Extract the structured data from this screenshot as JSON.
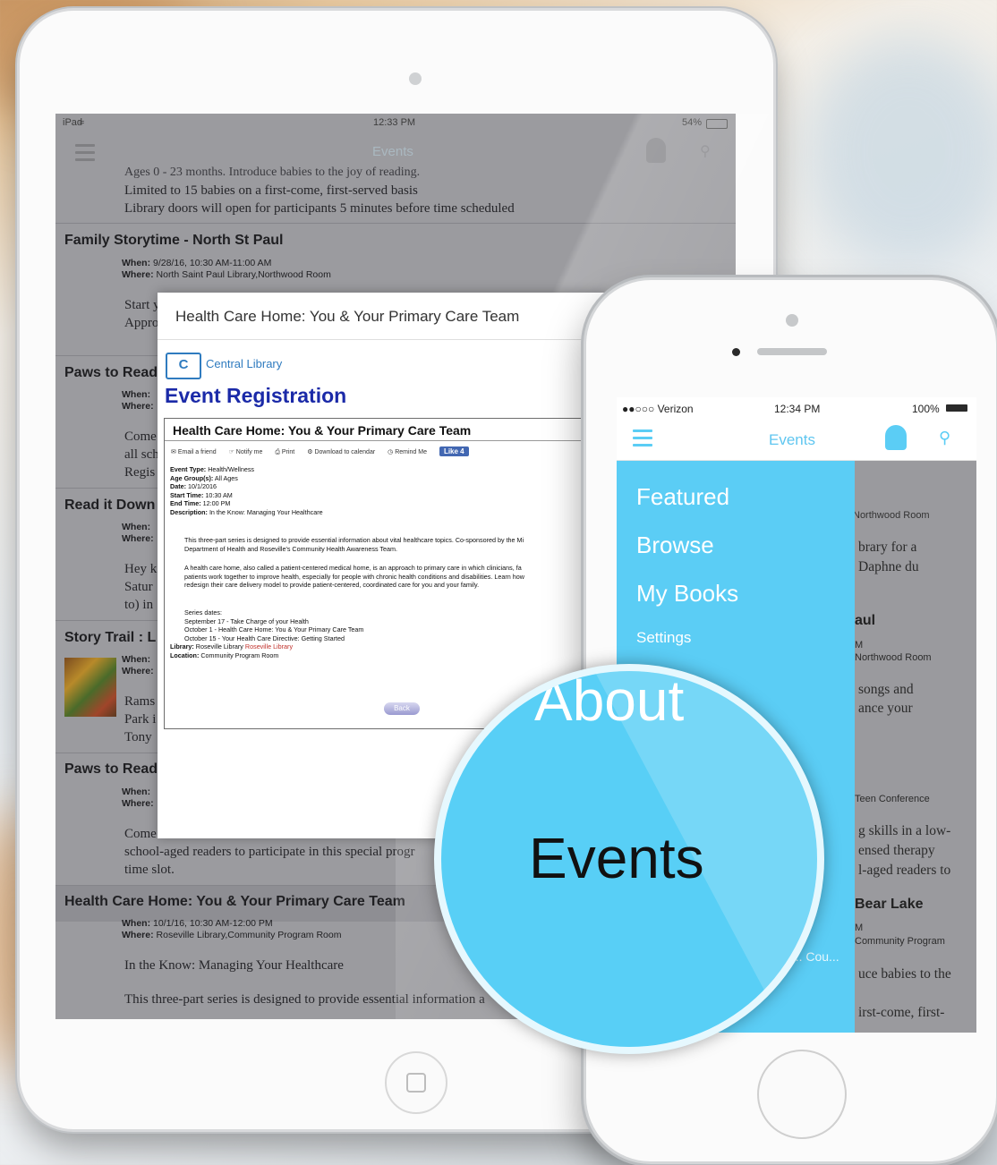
{
  "ipad": {
    "status": {
      "carrier": "iPad",
      "time": "12:33 PM",
      "battery": "54%"
    },
    "nav_title": "Events",
    "top_text": [
      "Ages 0 - 23 months. Introduce babies to the joy of reading.",
      "Limited to 15 babies on a first-come, first-served basis",
      "Library doors will open for participants 5 minutes before time scheduled"
    ],
    "events": [
      {
        "title": "Family Storytime - North St Paul",
        "when": "9/28/16, 10:30 AM-11:00 AM",
        "where": "North Saint Paul Library,Northwood Room",
        "body": [
          "Start y",
          "Appro"
        ]
      },
      {
        "title": "Paws to Read",
        "when": "",
        "where": "",
        "body": [
          "Come",
          "all sch",
          "Regis"
        ]
      },
      {
        "title": "Read it Down",
        "when": "",
        "where": "",
        "body": [
          "Hey k",
          "Satur",
          "to) in"
        ]
      },
      {
        "title": "Story Trail : L",
        "when": "",
        "where": "",
        "body": [
          "Rams",
          "Park i",
          "Tony"
        ]
      },
      {
        "title": "Paws to Read",
        "when": "",
        "where": "",
        "body": [
          "Come",
          "school-aged readers to participate in this special progr",
          "time slot."
        ]
      },
      {
        "title": "Health Care Home: You & Your Primary Care Team",
        "when": "10/1/16, 10:30 AM-12:00 PM",
        "where": "Roseville Library,Community Program Room",
        "body": [
          "In the Know: Managing Your Healthcare",
          "This three-part series is designed to provide essential information a"
        ]
      }
    ],
    "labels": {
      "when": "When:",
      "where": "Where:"
    },
    "modal": {
      "header": "Health Care Home: You & Your Primary Care Team",
      "library_logo": "C",
      "library_name": "Central Library",
      "heading": "Event Registration",
      "event_title": "Health Care Home: You & Your Primary Care Team",
      "tools": [
        "Email a friend",
        "Notify me",
        "Print",
        "Download to calendar",
        "Remind Me"
      ],
      "like": "Like 4",
      "details": [
        {
          "k": "Event Type:",
          "v": "Health/Wellness"
        },
        {
          "k": "Age Group(s):",
          "v": "All Ages"
        },
        {
          "k": "Date:",
          "v": "10/1/2016"
        },
        {
          "k": "Start Time:",
          "v": "10:30 AM"
        },
        {
          "k": "End Time:",
          "v": "12:00 PM"
        },
        {
          "k": "Description:",
          "v": "In the Know: Managing Your Healthcare"
        }
      ],
      "para1": [
        "This three-part series is designed to provide essential information about vital healthcare topics. Co-sponsored by the Mi",
        "Department of Health and Roseville's Community Health Awareness Team."
      ],
      "para2": [
        "A health care home, also called a patient-centered medical home, is an approach to primary care in which clinicians, fa",
        "patients work together to improve health, especially for people with chronic health conditions and disabilities. Learn how",
        "redesign their care delivery model to provide patient-centered, coordinated care for you and your family."
      ],
      "series": [
        "Series dates:",
        "September 17 - Take Charge of your Health",
        "October 1 - Health Care Home: You & Your Primary Care Team",
        "October 15 - Your Health Care Directive: Getting Started"
      ],
      "library_k": "Library:",
      "library_v": "Roseville Library",
      "library_link": "Roseville Library",
      "location_k": "Location:",
      "location_v": "Community Program Room",
      "back": "Back"
    }
  },
  "iphone": {
    "status": {
      "carrier": "●●○○○ Verizon",
      "time": "12:34 PM",
      "battery": "100%"
    },
    "nav_title": "Events",
    "menu": [
      "Featured",
      "Browse",
      "My Books",
      "Settings"
    ],
    "bg_snippets": [
      "Northwood Room",
      "brary for a",
      "Daphne du",
      "aul",
      "M",
      "Northwood Room",
      "songs and",
      "ance your",
      "Teen Conference",
      "g skills in a low-",
      "ensed therapy",
      "l-aged readers to",
      "Bear Lake",
      "M",
      "Community Program",
      "uce babies to the",
      "irst-come, first-",
      "a... Cou..."
    ]
  },
  "magnifier": {
    "about": "About",
    "events": "Events"
  },
  "colors": {
    "accent": "#5bcdf5",
    "modal_title": "#1b2aa8",
    "link": "#2f7bbf"
  }
}
